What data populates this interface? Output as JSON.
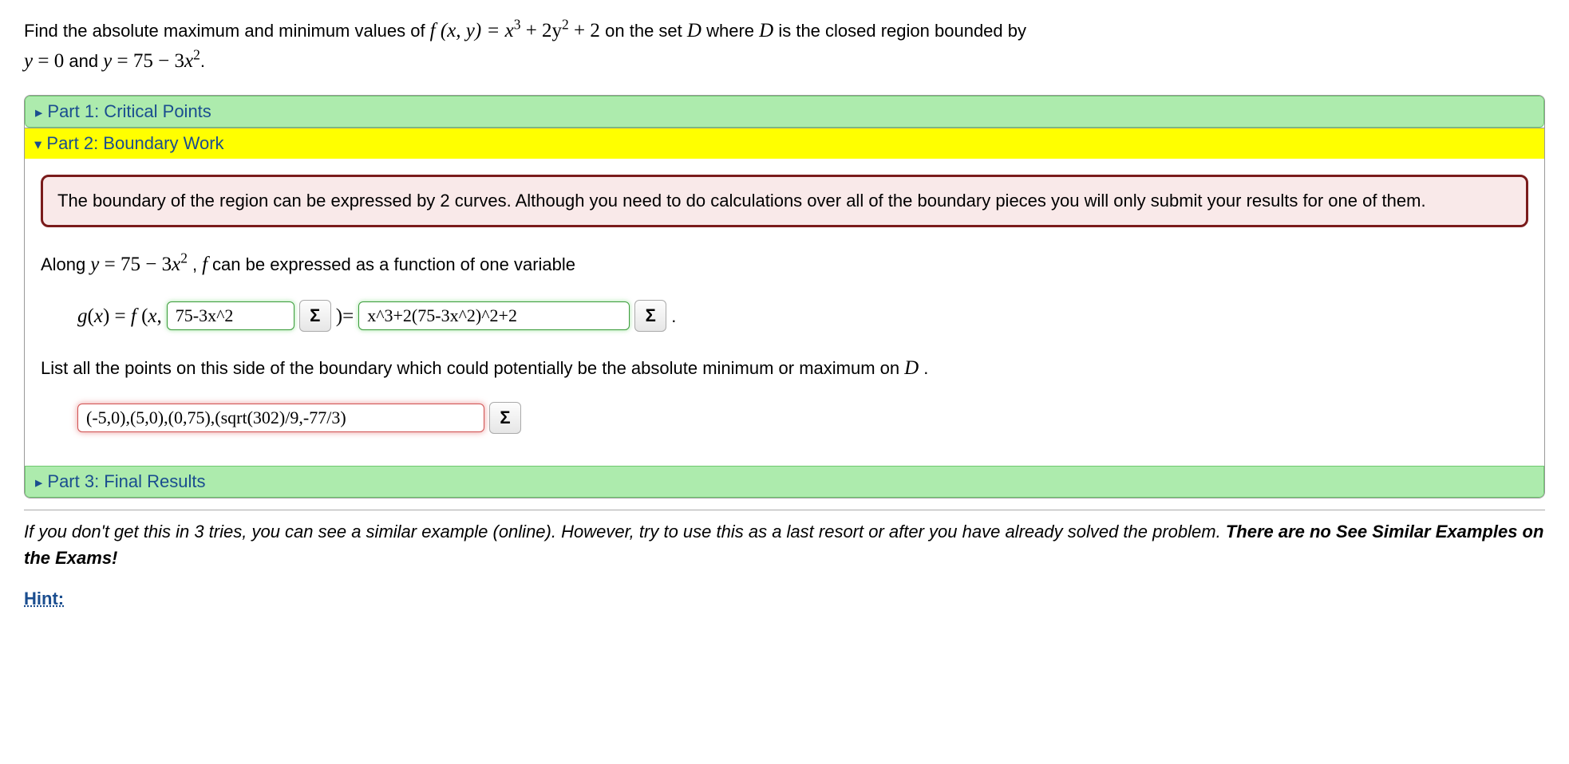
{
  "problem": {
    "intro": "Find the absolute maximum and minimum values of ",
    "fxy": "f (x, y) = x",
    "fxy_mid1": " + 2y",
    "fxy_end": " + 2",
    "on_set": " on the set ",
    "D1": "D",
    "where": " where ",
    "D2": "D",
    "closed": " is the closed region bounded by ",
    "line2a": "y = 0",
    "and": " and ",
    "line2b": "y = 75 − 3x",
    "period": "."
  },
  "parts": {
    "p1": "Part 1: Critical Points",
    "p2": "Part 2: Boundary Work",
    "p3": "Part 3: Final Results"
  },
  "infobox": "The boundary of the region can be expressed by 2 curves. Although you need to do calculations over all of the boundary pieces you will only submit your results for one of them.",
  "along": {
    "pre": "Along ",
    "curve": "y = 75 − 3x",
    "post_comma": ", ",
    "f": "f",
    "tail": " can be expressed as a function of one variable"
  },
  "gx": {
    "lhs1": "g(x) = f (x,",
    "input1": "75-3x^2",
    "mid": ")= ",
    "input2": "x^3+2(75-3x^2)^2+2",
    "period": "."
  },
  "listPoints": "List all the points on this side of the boundary which could potentially be the absolute minimum or maximum on ",
  "D3": "D",
  "listPeriod": ".",
  "pointsInput": "(-5,0),(5,0),(0,75),(sqrt(302)/9,-77/3)",
  "sigma": "Σ",
  "footer": {
    "italic": "If you don't get this in 3 tries, you can see a similar example (online). However, try to use this as a last resort or after you have already solved the problem. ",
    "bold": "There are no See Similar Examples on the Exams!"
  },
  "hint": "Hint:"
}
